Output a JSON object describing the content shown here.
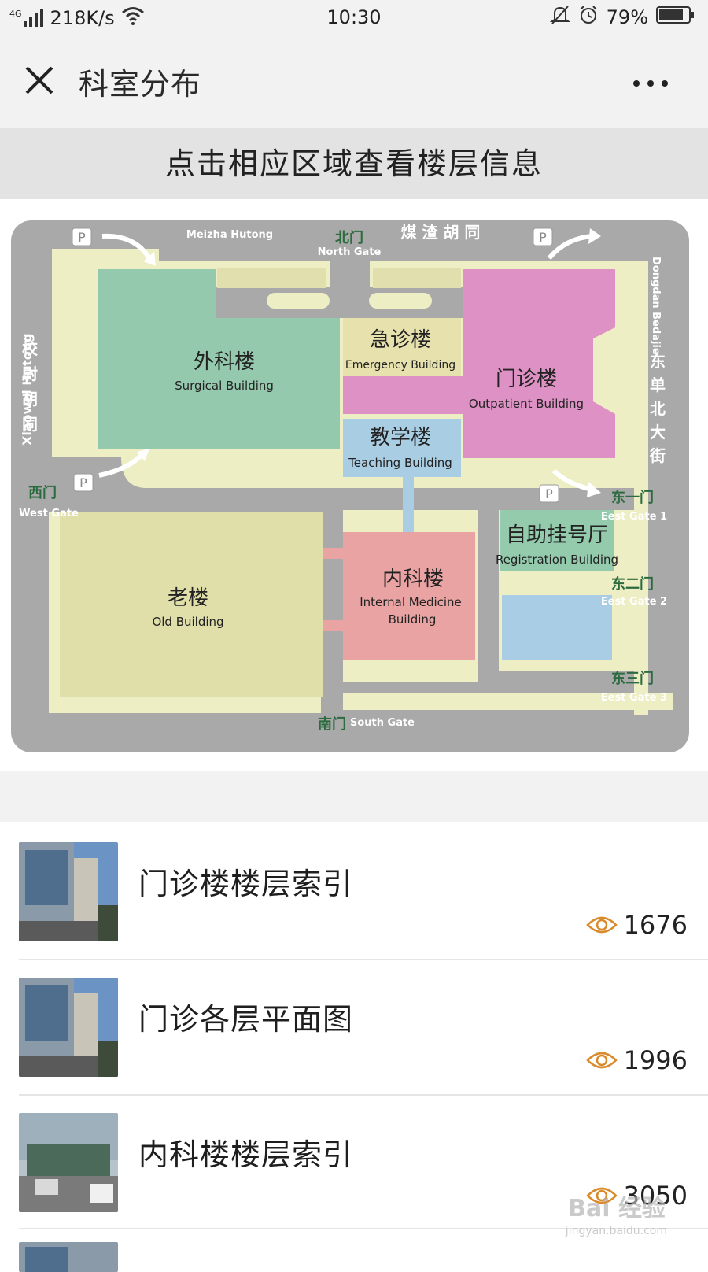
{
  "status_bar": {
    "network": "4G",
    "speed": "218K/s",
    "time": "10:30",
    "battery": "79%"
  },
  "nav": {
    "title": "科室分布",
    "close_icon": "close-icon",
    "more_icon": "more-icon"
  },
  "hint": "点击相应区域查看楼层信息",
  "map": {
    "streets": {
      "north_en": "Meizha Hutong",
      "north_cn": "煤 渣 胡 同",
      "east_en": "Dongdan Bedajie",
      "east_cn": [
        "东",
        "单",
        "北",
        "大",
        "街"
      ],
      "west_cn": [
        "校",
        "尉",
        "胡",
        "同"
      ],
      "west_en": "Xiaowei Hutong"
    },
    "gates": {
      "north_cn": "北门",
      "north_en": "North Gate",
      "west_cn": "西门",
      "west_en": "West Gate",
      "south_cn": "南门",
      "south_en": "South Gate",
      "east1_cn": "东一门",
      "east1_en": "Eest Gate 1",
      "east2_cn": "东二门",
      "east2_en": "Eest Gate 2",
      "east3_cn": "东三门",
      "east3_en": "Eest Gate 3"
    },
    "buildings": {
      "surgical": {
        "cn": "外科楼",
        "en": "Surgical Building"
      },
      "emergency": {
        "cn": "急诊楼",
        "en": "Emergency Building"
      },
      "outpatient": {
        "cn": "门诊楼",
        "en": "Outpatient Building"
      },
      "teaching": {
        "cn": "教学楼",
        "en": "Teaching Building"
      },
      "registration": {
        "cn": "自助挂号厅",
        "en": "Registration Building"
      },
      "old": {
        "cn": "老楼",
        "en": "Old Building"
      },
      "internal": {
        "cn": "内科楼",
        "en1": "Internal Medicine",
        "en2": "Building"
      }
    },
    "colors": {
      "road": "#a9a9a9",
      "ground": "#eeeec4",
      "surgical": "#95c9ae",
      "outpatient": "#de91c4",
      "emergency": "#e6e1ad",
      "teaching": "#a9cde3",
      "internal": "#e8a3a2",
      "old": "#e0dfaa",
      "registration": "#94cbad",
      "gate_label": "#2c6b3f"
    }
  },
  "list": [
    {
      "title": "门诊楼楼层索引",
      "views": "1676",
      "icon": "eye-icon"
    },
    {
      "title": "门诊各层平面图",
      "views": "1996",
      "icon": "eye-icon"
    },
    {
      "title": "内科楼楼层索引",
      "views": "3050",
      "icon": "eye-icon"
    }
  ],
  "watermark": {
    "brand": "Bai 经验",
    "url": "jingyan.baidu.com"
  }
}
